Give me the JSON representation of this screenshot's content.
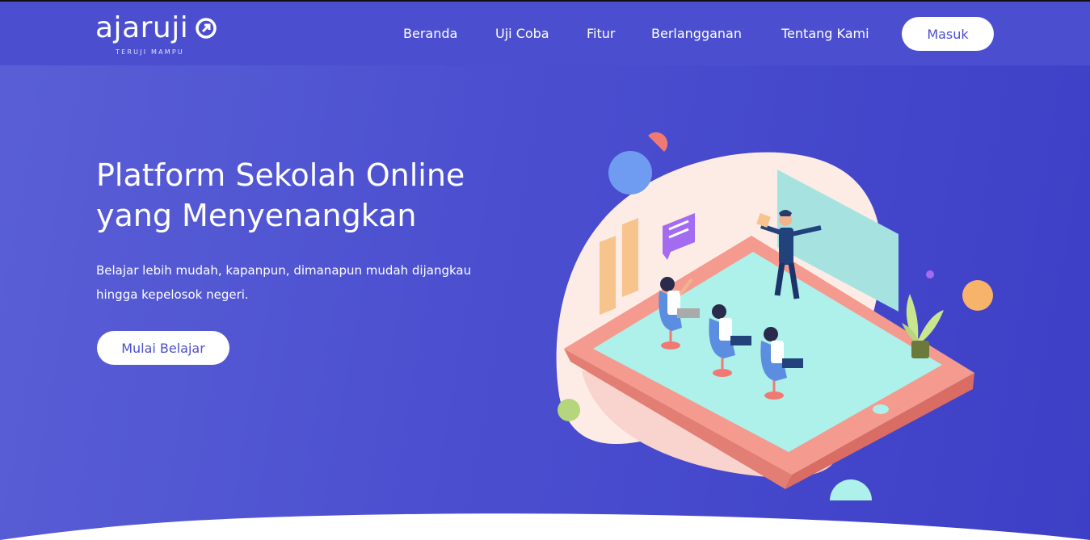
{
  "brand": {
    "logo_text": "ajaruji",
    "tagline": "TERUJI MAMPU"
  },
  "nav": {
    "items": [
      {
        "label": "Beranda"
      },
      {
        "label": "Uji Coba"
      },
      {
        "label": "Fitur"
      },
      {
        "label": "Berlangganan"
      },
      {
        "label": "Tentang Kami"
      }
    ],
    "login_label": "Masuk"
  },
  "hero": {
    "headline_line1": "Platform Sekolah Online",
    "headline_line2": "yang Menyenangkan",
    "subtext_line1": "Belajar lebih mudah, kapanpun, dimanapun mudah dijangkau",
    "subtext_line2": "hingga kepelosok negeri.",
    "cta_label": "Mulai Belajar"
  },
  "colors": {
    "primary": "#4b4fcf",
    "background_dark": "#3d3fc6",
    "white": "#ffffff",
    "tablet_frame": "#f08f84",
    "tablet_screen": "#aef0ea",
    "accent_orange": "#f7b36a",
    "accent_blue": "#6f9bf0",
    "accent_green": "#b5d67c"
  }
}
